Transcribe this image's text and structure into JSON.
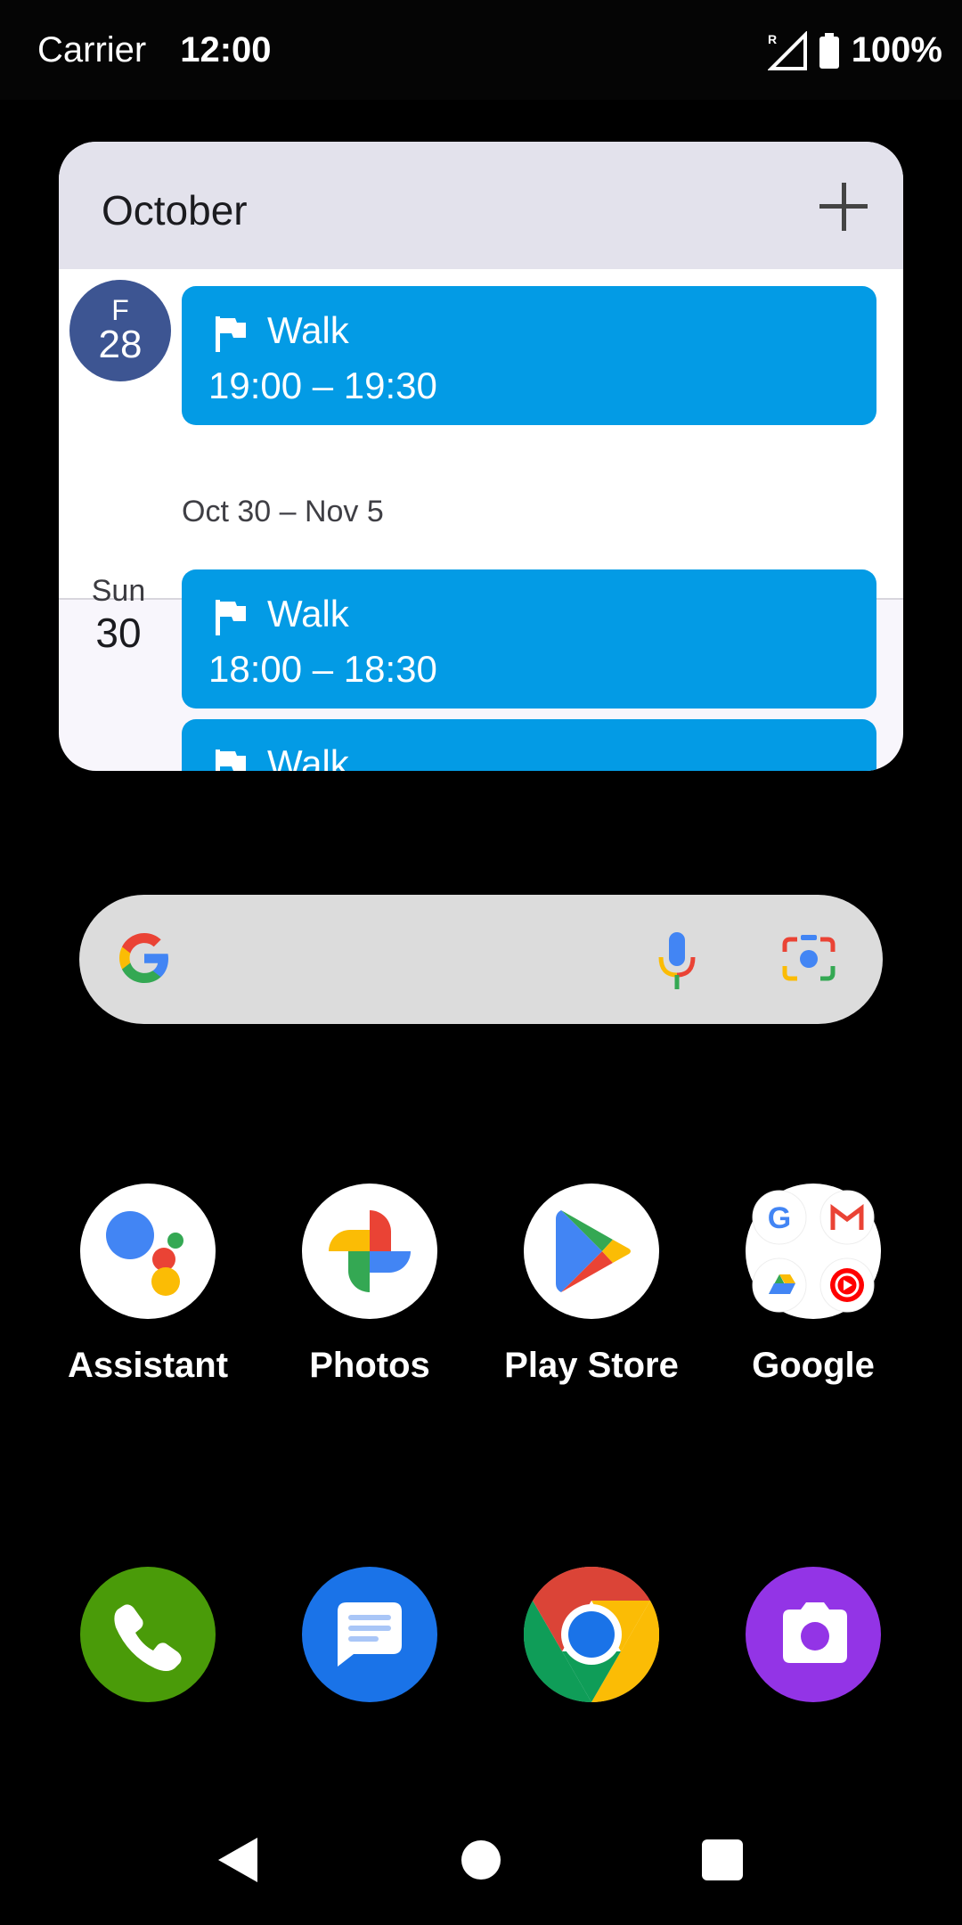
{
  "status_bar": {
    "carrier": "Carrier",
    "time": "12:00",
    "battery": "100%",
    "roaming": "R"
  },
  "calendar_widget": {
    "month": "October",
    "add_icon": "plus-icon",
    "first_day": {
      "dow": "F",
      "day": "28"
    },
    "events": [
      {
        "title": "Walk",
        "time": "19:00 – 19:30"
      },
      {
        "title": "Walk",
        "time": "18:00 – 18:30"
      },
      {
        "title": "Walk",
        "time": ""
      }
    ],
    "week_range": "Oct 30 – Nov 5",
    "second_day": {
      "dow": "Sun",
      "day": "30"
    }
  },
  "search_bar": {
    "google_icon": "google-icon",
    "mic_icon": "mic-icon",
    "lens_icon": "lens-icon"
  },
  "apps": [
    {
      "label": "Assistant"
    },
    {
      "label": "Photos"
    },
    {
      "label": "Play Store"
    },
    {
      "label": "Google"
    }
  ],
  "dock": [
    "phone-icon",
    "messages-icon",
    "chrome-icon",
    "camera-icon"
  ],
  "navigation": [
    "back",
    "home",
    "recents"
  ]
}
